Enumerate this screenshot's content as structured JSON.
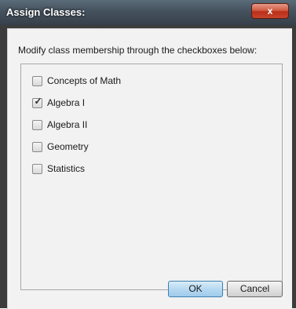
{
  "window": {
    "title": "Assign Classes:",
    "close_label": "x"
  },
  "instruction": "Modify class membership through the checkboxes below:",
  "classes": [
    {
      "label": "Concepts of Math",
      "checked": false
    },
    {
      "label": "Algebra I",
      "checked": true
    },
    {
      "label": "Algebra II",
      "checked": false
    },
    {
      "label": "Geometry",
      "checked": false
    },
    {
      "label": "Statistics",
      "checked": false
    }
  ],
  "checkmark_glyph": "✓",
  "buttons": {
    "ok_label": "OK",
    "cancel_label": "Cancel"
  }
}
